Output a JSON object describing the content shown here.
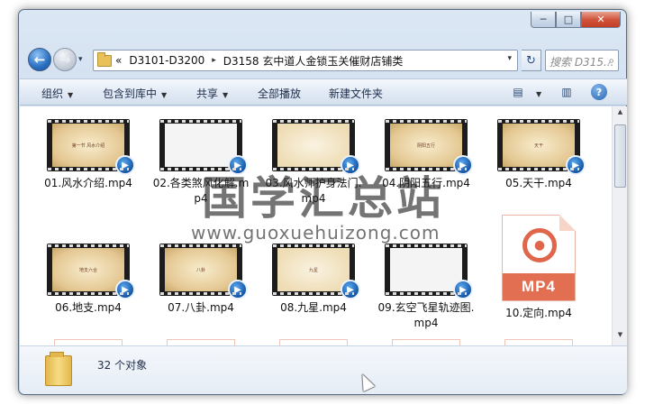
{
  "window": {
    "controls": {
      "minimize": "─",
      "maximize": "□",
      "close": "✕"
    }
  },
  "nav": {
    "back_icon": "←",
    "forward_icon": "→",
    "history_icon": "▾",
    "breadcrumb": {
      "overflow": "«",
      "items": [
        "D3101-D3200",
        "D3158 玄中道人金锁玉关催财店铺类"
      ],
      "separator": "▸"
    },
    "address_dropdown": "▾",
    "refresh_icon": "↻",
    "search_placeholder": "搜索 D315...",
    "search_icon": "⌕"
  },
  "toolbar": {
    "organize": "组织",
    "include_in_library": "包含到库中",
    "share": "共享",
    "play_all": "全部播放",
    "new_folder": "新建文件夹",
    "dropdown_arrow": "▼",
    "view_icon": "▤",
    "pane_icon": "▥",
    "help_icon": "?"
  },
  "files": [
    {
      "label": "01.风水介绍.mp4",
      "slide_text": "第一节 风水介绍"
    },
    {
      "label": "02.各类煞风化解.mp4",
      "slide_text": ""
    },
    {
      "label": "03.风水师护身法门.mp4",
      "slide_text": ""
    },
    {
      "label": "04.阴阳五行.mp4",
      "slide_text": "阴阳五行"
    },
    {
      "label": "05.天干.mp4",
      "slide_text": "天干"
    },
    {
      "label": "06.地支.mp4",
      "slide_text": "地支六合"
    },
    {
      "label": "07.八卦.mp4",
      "slide_text": "八卦"
    },
    {
      "label": "08.九星.mp4",
      "slide_text": "九星"
    },
    {
      "label": "09.玄空飞星轨迹图.mp4",
      "slide_text": ""
    },
    {
      "label": "10.定向.mp4",
      "doc_text": "MP4"
    }
  ],
  "video_badge_icon": "▶",
  "mp4_logo_icon": "●",
  "status": {
    "count": "32 个对象"
  },
  "watermark": {
    "main": "国学汇总站",
    "sub": "www.guoxuehuizong.com"
  }
}
